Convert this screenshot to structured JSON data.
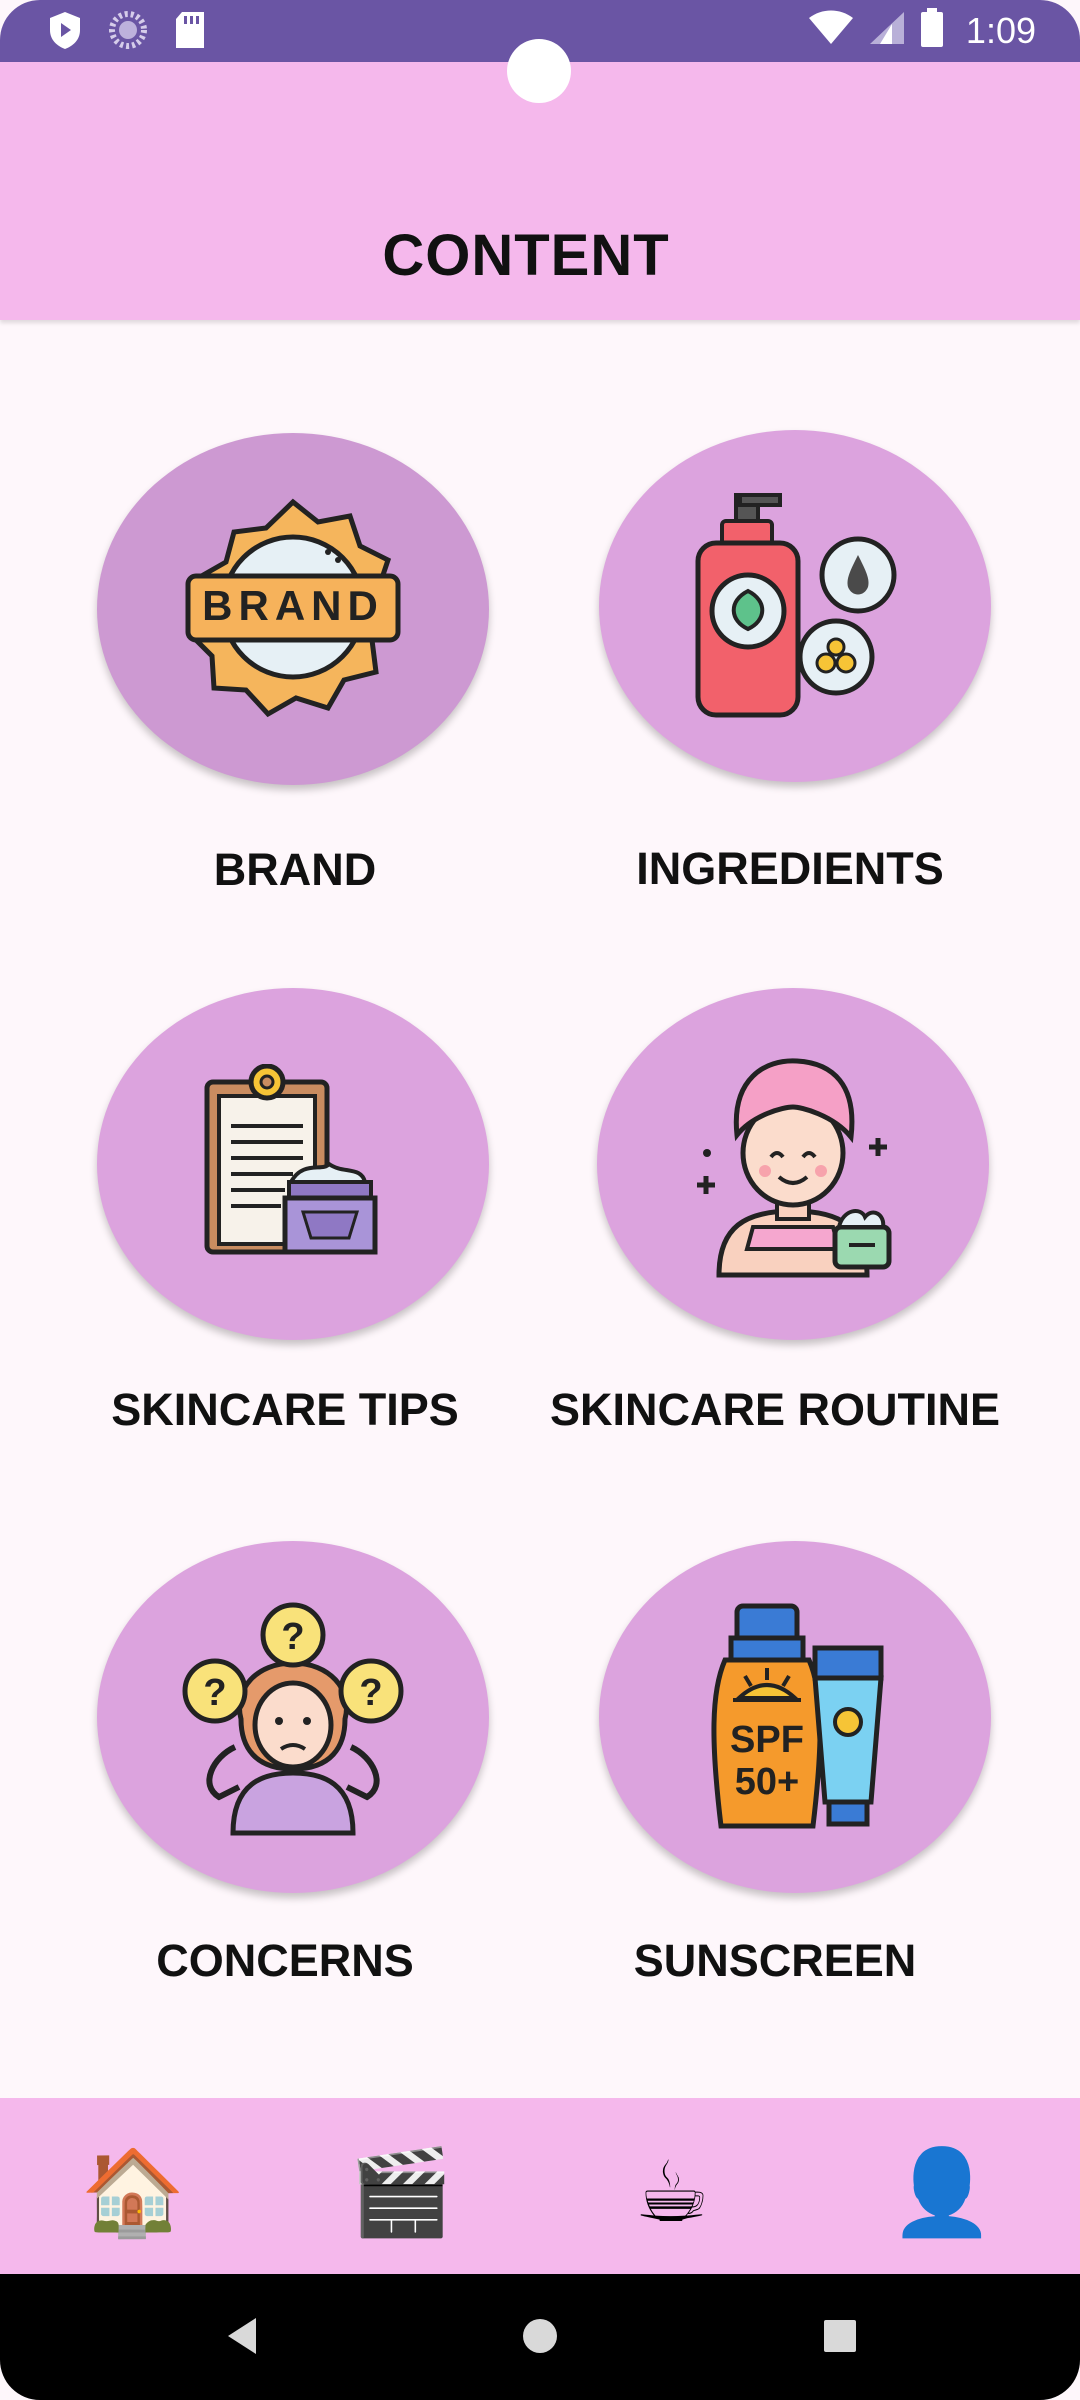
{
  "status_bar": {
    "time": "1:09",
    "left_icons": [
      "shield-icon",
      "loading-icon",
      "sd-card-icon"
    ],
    "right_icons": [
      "wifi-icon",
      "cell-signal-icon",
      "battery-icon"
    ]
  },
  "header": {
    "title": "CONTENT"
  },
  "categories": [
    {
      "label": "BRAND",
      "icon": "brand-badge-icon"
    },
    {
      "label": "INGREDIENTS",
      "icon": "pump-bottle-icon"
    },
    {
      "label": "SKINCARE TIPS",
      "icon": "clipboard-cream-icon"
    },
    {
      "label": "SKINCARE ROUTINE",
      "icon": "face-towel-icon"
    },
    {
      "label": "CONCERNS",
      "icon": "confused-person-icon"
    },
    {
      "label": "SUNSCREEN",
      "icon": "sunscreen-icon"
    }
  ],
  "brand_badge_text": "BRAND",
  "sunscreen_text": [
    "SPF",
    "50+"
  ],
  "bottom_nav": [
    {
      "name": "home",
      "glyph": "🏠"
    },
    {
      "name": "videos",
      "glyph": "🎬"
    },
    {
      "name": "cafe",
      "glyph": "☕"
    },
    {
      "name": "profile",
      "glyph": "👤"
    }
  ],
  "colors": {
    "status_bar": "#6a55a4",
    "header": "#f5b8ec",
    "circle": "#dca3de",
    "circle_active": "#cd99d2",
    "background": "#fef7fb"
  }
}
